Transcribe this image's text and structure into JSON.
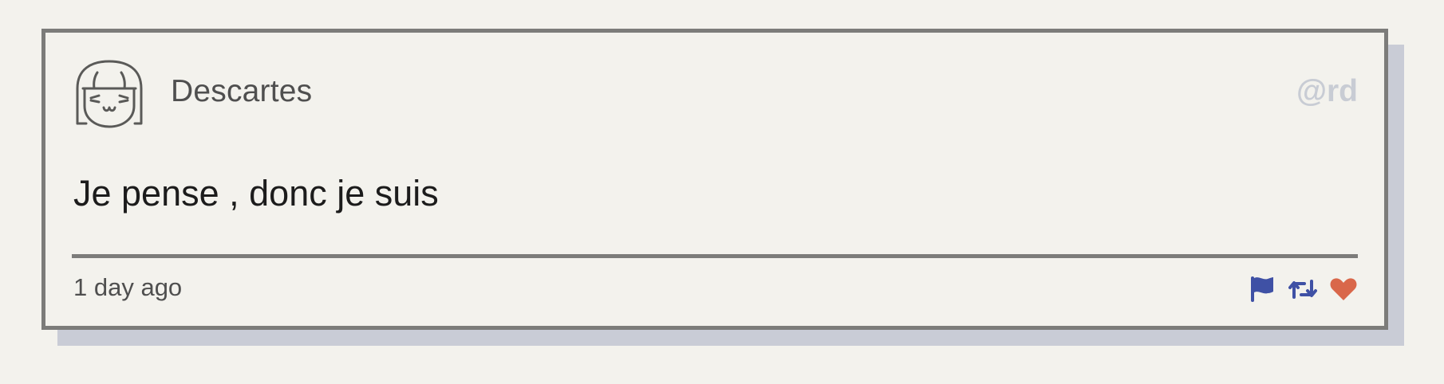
{
  "post": {
    "author_name": "Descartes",
    "handle": "@rd",
    "message": "Je pense , donc je suis",
    "time": "1 day ago"
  },
  "icons": {
    "avatar": "girl-face-avatar-icon",
    "flag": "flag-icon",
    "retweet": "retweet-icon",
    "like": "heart-icon"
  },
  "colors": {
    "background": "#f3f2ed",
    "border": "#7c7c7a",
    "shadow": "#c9ccd6",
    "handle": "#c8ccd4",
    "flag": "#3f51a5",
    "retweet": "#3f51a5",
    "heart": "#d9674a"
  }
}
